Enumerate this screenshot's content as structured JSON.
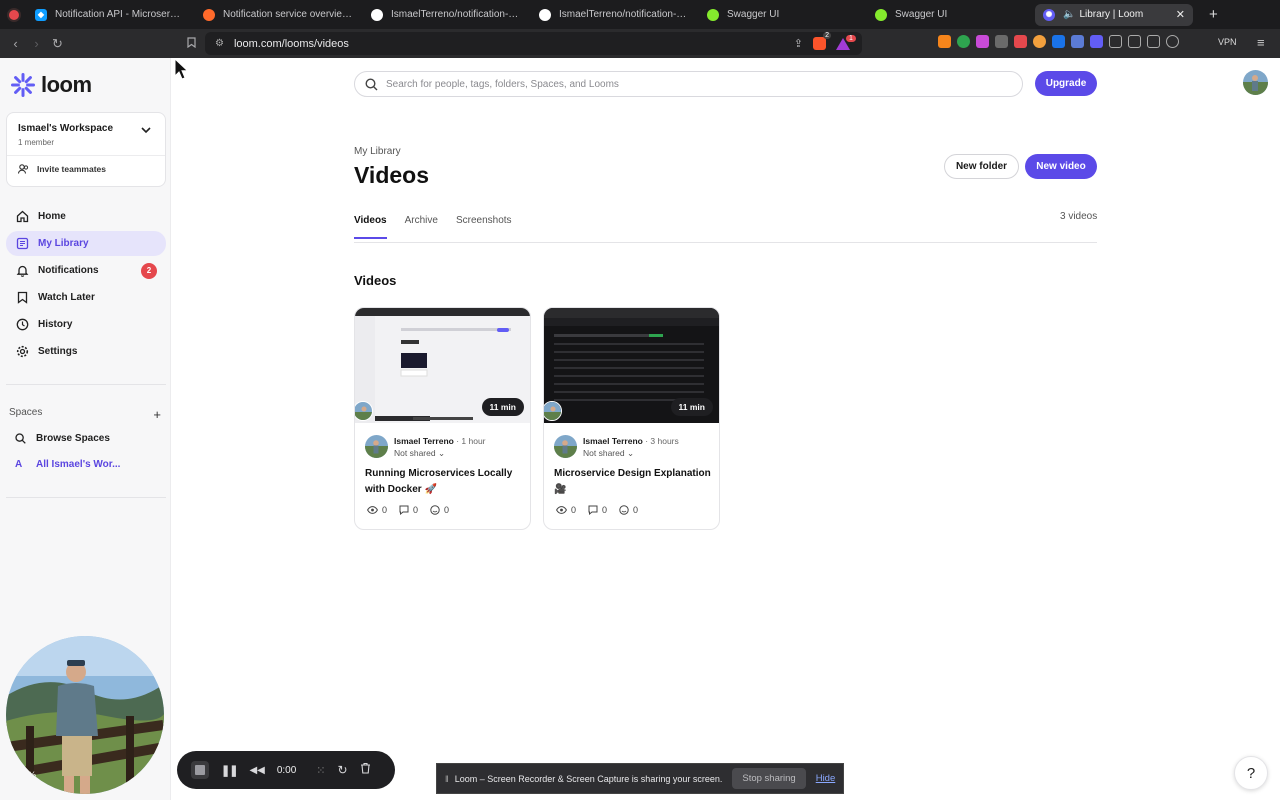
{
  "browser": {
    "tabs": [
      {
        "title": "Notification API - Microservice Ar",
        "color": "#0f9dff"
      },
      {
        "title": "Notification service overview - St",
        "color": "#ff6a2b"
      },
      {
        "title": "IsmaelTerreno/notification-etl-se",
        "color": "#ffffff"
      },
      {
        "title": "IsmaelTerreno/notification-worke",
        "color": "#ffffff"
      },
      {
        "title": "Swagger UI",
        "color": "#85ea2d"
      },
      {
        "title": "Swagger UI",
        "color": "#85ea2d"
      },
      {
        "title": "Library | Loom",
        "color": "#625df5",
        "active": true
      }
    ],
    "url": "loom.com/looms/videos",
    "vpn_label": "VPN",
    "brave_badge": "2",
    "alert_badge": "1"
  },
  "sidebar": {
    "brand": "loom",
    "workspace": {
      "name": "Ismael's Workspace",
      "members": "1 member",
      "invite_label": "Invite teammates"
    },
    "nav": [
      {
        "label": "Home",
        "icon": "home-icon"
      },
      {
        "label": "My Library",
        "icon": "library-icon",
        "active": true
      },
      {
        "label": "Notifications",
        "icon": "bell-icon",
        "badge": "2"
      },
      {
        "label": "Watch Later",
        "icon": "bookmark-icon"
      },
      {
        "label": "History",
        "icon": "clock-icon"
      },
      {
        "label": "Settings",
        "icon": "gear-icon"
      }
    ],
    "spaces": {
      "header": "Spaces",
      "browse_label": "Browse Spaces",
      "workspace_label": "All Ismael's Wor...",
      "workspace_initial": "A"
    },
    "camera_zoom": "50%"
  },
  "header": {
    "search_placeholder": "Search for people, tags, folders, Spaces, and Looms",
    "upgrade_label": "Upgrade"
  },
  "main": {
    "breadcrumb": "My Library",
    "title": "Videos",
    "new_folder_label": "New folder",
    "new_video_label": "New video",
    "tabs": [
      {
        "label": "Videos",
        "active": true
      },
      {
        "label": "Archive"
      },
      {
        "label": "Screenshots"
      }
    ],
    "count": "3 videos",
    "section_title": "Videos",
    "videos": [
      {
        "duration": "11 min",
        "author": "Ismael Terreno",
        "ago": "· 1 hour",
        "sharing": "Not shared",
        "title": "Running Microservices Locally with Docker 🚀",
        "views": "0",
        "comments": "0",
        "reactions": "0"
      },
      {
        "duration": "11 min",
        "author": "Ismael Terreno",
        "ago": "· 3 hours",
        "sharing": "Not shared",
        "title": "Microservice Design Explanation 🎥",
        "views": "0",
        "comments": "0",
        "reactions": "0"
      }
    ]
  },
  "recorder": {
    "time": "0:00"
  },
  "banner": {
    "message": "Loom – Screen Recorder & Screen Capture is sharing your screen.",
    "stop_label": "Stop sharing",
    "hide_label": "Hide"
  },
  "help_label": "?"
}
